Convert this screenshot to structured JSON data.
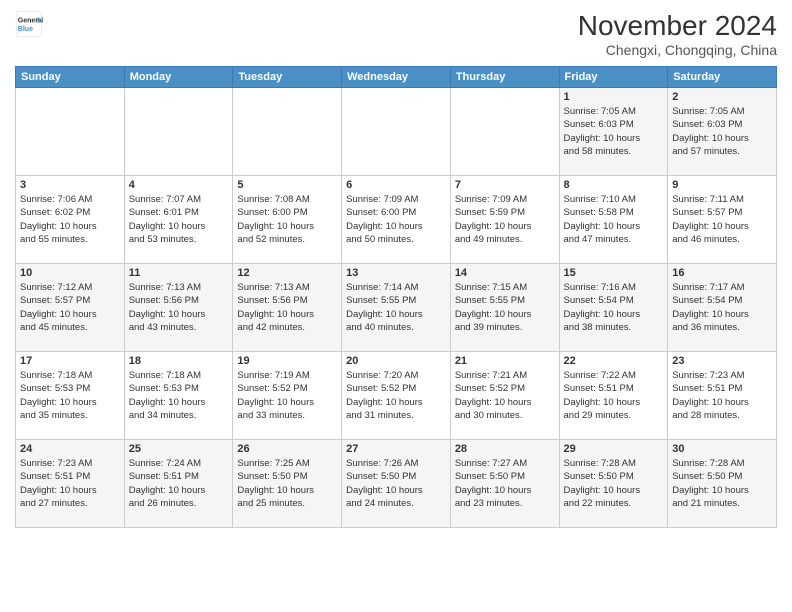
{
  "header": {
    "logo_line1": "General",
    "logo_line2": "Blue",
    "month": "November 2024",
    "location": "Chengxi, Chongqing, China"
  },
  "days_of_week": [
    "Sunday",
    "Monday",
    "Tuesday",
    "Wednesday",
    "Thursday",
    "Friday",
    "Saturday"
  ],
  "weeks": [
    [
      {
        "day": "",
        "info": ""
      },
      {
        "day": "",
        "info": ""
      },
      {
        "day": "",
        "info": ""
      },
      {
        "day": "",
        "info": ""
      },
      {
        "day": "",
        "info": ""
      },
      {
        "day": "1",
        "info": "Sunrise: 7:05 AM\nSunset: 6:03 PM\nDaylight: 10 hours\nand 58 minutes."
      },
      {
        "day": "2",
        "info": "Sunrise: 7:05 AM\nSunset: 6:03 PM\nDaylight: 10 hours\nand 57 minutes."
      }
    ],
    [
      {
        "day": "3",
        "info": "Sunrise: 7:06 AM\nSunset: 6:02 PM\nDaylight: 10 hours\nand 55 minutes."
      },
      {
        "day": "4",
        "info": "Sunrise: 7:07 AM\nSunset: 6:01 PM\nDaylight: 10 hours\nand 53 minutes."
      },
      {
        "day": "5",
        "info": "Sunrise: 7:08 AM\nSunset: 6:00 PM\nDaylight: 10 hours\nand 52 minutes."
      },
      {
        "day": "6",
        "info": "Sunrise: 7:09 AM\nSunset: 6:00 PM\nDaylight: 10 hours\nand 50 minutes."
      },
      {
        "day": "7",
        "info": "Sunrise: 7:09 AM\nSunset: 5:59 PM\nDaylight: 10 hours\nand 49 minutes."
      },
      {
        "day": "8",
        "info": "Sunrise: 7:10 AM\nSunset: 5:58 PM\nDaylight: 10 hours\nand 47 minutes."
      },
      {
        "day": "9",
        "info": "Sunrise: 7:11 AM\nSunset: 5:57 PM\nDaylight: 10 hours\nand 46 minutes."
      }
    ],
    [
      {
        "day": "10",
        "info": "Sunrise: 7:12 AM\nSunset: 5:57 PM\nDaylight: 10 hours\nand 45 minutes."
      },
      {
        "day": "11",
        "info": "Sunrise: 7:13 AM\nSunset: 5:56 PM\nDaylight: 10 hours\nand 43 minutes."
      },
      {
        "day": "12",
        "info": "Sunrise: 7:13 AM\nSunset: 5:56 PM\nDaylight: 10 hours\nand 42 minutes."
      },
      {
        "day": "13",
        "info": "Sunrise: 7:14 AM\nSunset: 5:55 PM\nDaylight: 10 hours\nand 40 minutes."
      },
      {
        "day": "14",
        "info": "Sunrise: 7:15 AM\nSunset: 5:55 PM\nDaylight: 10 hours\nand 39 minutes."
      },
      {
        "day": "15",
        "info": "Sunrise: 7:16 AM\nSunset: 5:54 PM\nDaylight: 10 hours\nand 38 minutes."
      },
      {
        "day": "16",
        "info": "Sunrise: 7:17 AM\nSunset: 5:54 PM\nDaylight: 10 hours\nand 36 minutes."
      }
    ],
    [
      {
        "day": "17",
        "info": "Sunrise: 7:18 AM\nSunset: 5:53 PM\nDaylight: 10 hours\nand 35 minutes."
      },
      {
        "day": "18",
        "info": "Sunrise: 7:18 AM\nSunset: 5:53 PM\nDaylight: 10 hours\nand 34 minutes."
      },
      {
        "day": "19",
        "info": "Sunrise: 7:19 AM\nSunset: 5:52 PM\nDaylight: 10 hours\nand 33 minutes."
      },
      {
        "day": "20",
        "info": "Sunrise: 7:20 AM\nSunset: 5:52 PM\nDaylight: 10 hours\nand 31 minutes."
      },
      {
        "day": "21",
        "info": "Sunrise: 7:21 AM\nSunset: 5:52 PM\nDaylight: 10 hours\nand 30 minutes."
      },
      {
        "day": "22",
        "info": "Sunrise: 7:22 AM\nSunset: 5:51 PM\nDaylight: 10 hours\nand 29 minutes."
      },
      {
        "day": "23",
        "info": "Sunrise: 7:23 AM\nSunset: 5:51 PM\nDaylight: 10 hours\nand 28 minutes."
      }
    ],
    [
      {
        "day": "24",
        "info": "Sunrise: 7:23 AM\nSunset: 5:51 PM\nDaylight: 10 hours\nand 27 minutes."
      },
      {
        "day": "25",
        "info": "Sunrise: 7:24 AM\nSunset: 5:51 PM\nDaylight: 10 hours\nand 26 minutes."
      },
      {
        "day": "26",
        "info": "Sunrise: 7:25 AM\nSunset: 5:50 PM\nDaylight: 10 hours\nand 25 minutes."
      },
      {
        "day": "27",
        "info": "Sunrise: 7:26 AM\nSunset: 5:50 PM\nDaylight: 10 hours\nand 24 minutes."
      },
      {
        "day": "28",
        "info": "Sunrise: 7:27 AM\nSunset: 5:50 PM\nDaylight: 10 hours\nand 23 minutes."
      },
      {
        "day": "29",
        "info": "Sunrise: 7:28 AM\nSunset: 5:50 PM\nDaylight: 10 hours\nand 22 minutes."
      },
      {
        "day": "30",
        "info": "Sunrise: 7:28 AM\nSunset: 5:50 PM\nDaylight: 10 hours\nand 21 minutes."
      }
    ]
  ]
}
